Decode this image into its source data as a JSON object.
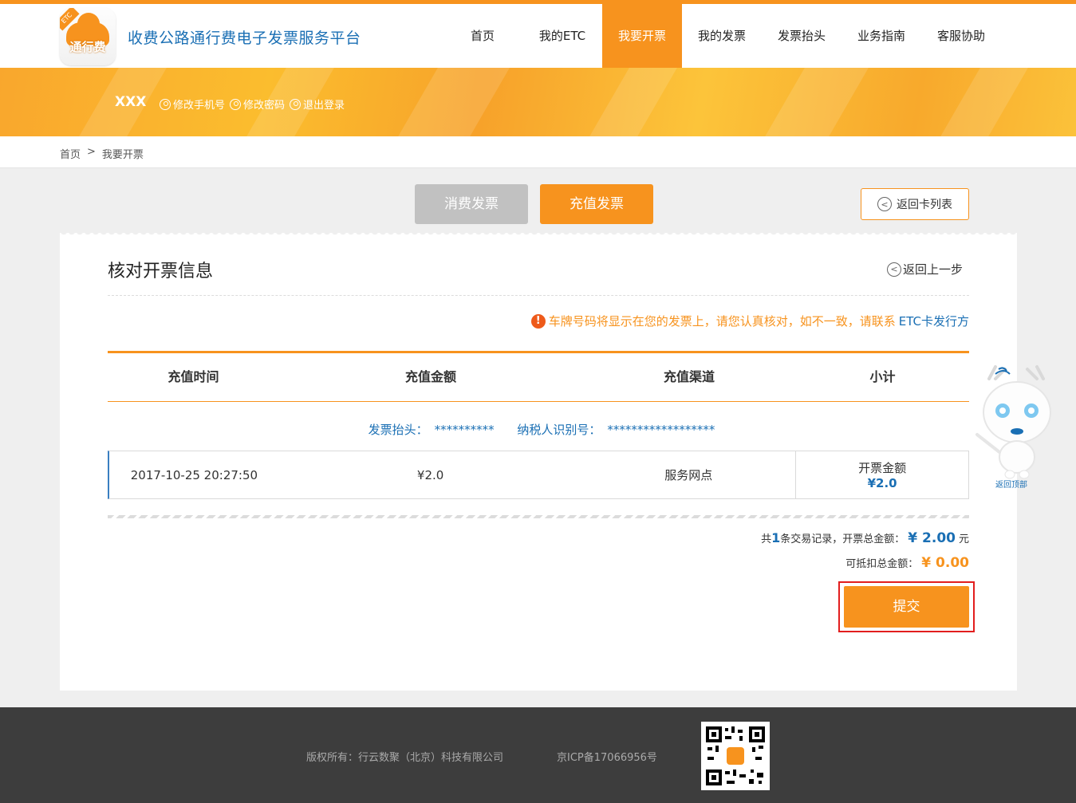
{
  "header": {
    "logo_text": "通行费",
    "logo_tag": "ETC",
    "site_title": "收费公路通行费电子发票服务平台",
    "nav": [
      {
        "label": "首页",
        "active": false
      },
      {
        "label": "我的ETC",
        "active": false
      },
      {
        "label": "我要开票",
        "active": true
      },
      {
        "label": "我的发票",
        "active": false
      },
      {
        "label": "发票抬头",
        "active": false
      },
      {
        "label": "业务指南",
        "active": false
      },
      {
        "label": "客服协助",
        "active": false
      }
    ]
  },
  "user": {
    "name": "XXX",
    "links": [
      "修改手机号",
      "修改密码",
      "退出登录"
    ]
  },
  "breadcrumb": {
    "home": "首页",
    "separator": ">",
    "current": "我要开票"
  },
  "tabs": {
    "consume": "消费发票",
    "recharge": "充值发票",
    "active": "recharge"
  },
  "back_list_label": "返回卡列表",
  "card": {
    "title": "核对开票信息",
    "back_step": "返回上一步",
    "notice_prefix": "车牌号码将显示在您的发票上，请您认真核对，如不一致，请联系",
    "notice_etc": "ETC卡发行方",
    "table": {
      "headers": [
        "充值时间",
        "充值金额",
        "充值渠道",
        "小计"
      ],
      "invoice_title_label": "发票抬头：",
      "invoice_title_value": "**********",
      "taxpayer_label": "纳税人识别号：",
      "taxpayer_value": "******************",
      "rows": [
        {
          "time": "2017-10-25 20:27:50",
          "amount": "¥2.0",
          "channel": "服务网点",
          "subtotal_label": "开票金额",
          "subtotal": "¥2.0"
        }
      ]
    },
    "summary": {
      "prefix": "共",
      "count": "1",
      "mid": "条交易记录，开票总金额：",
      "total": "¥ 2.00",
      "unit": "元",
      "deduct_label": "可抵扣总金额：",
      "deduct": "¥ 0.00"
    },
    "submit": "提交"
  },
  "mascot_label": "返回顶部",
  "footer": {
    "copyright": "版权所有：行云数聚（北京）科技有限公司",
    "icp": "京ICP备17066956号"
  },
  "colors": {
    "accent": "#f7931e",
    "link": "#1a6fb4",
    "highlight_border": "#e21e1e"
  }
}
